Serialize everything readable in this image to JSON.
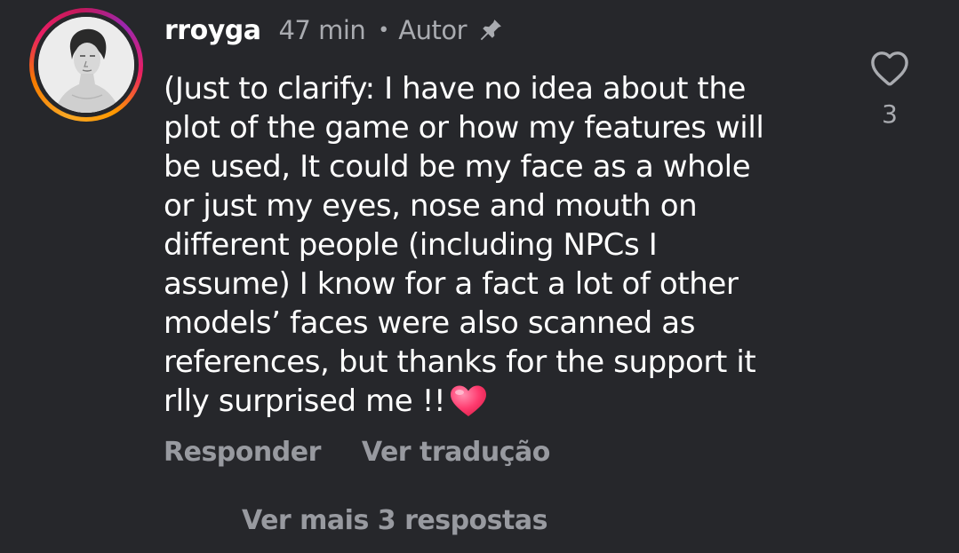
{
  "comment": {
    "username": "rroyga",
    "time": "47 min",
    "separator": "•",
    "role": "Autor",
    "pin_icon": "pin-icon",
    "avatar_icon": "avatar-photo",
    "text": "(Just to clarify: I have no idea about the\nplot of the game or how my features will\nbe used, It could be my face as a whole\nor just my eyes, nose and mouth on\ndifferent people (including NPCs I\nassume) I know for a fact a lot of other\nmodels’ faces were also scanned as\nreferences, but thanks for the support it\nrlly surprised me !!",
    "emoji_icon": "pink-heart-emoji",
    "like_icon": "heart-outline-icon",
    "like_count": "3"
  },
  "actions": {
    "reply_label": "Responder",
    "translate_label": "Ver tradução"
  },
  "replies": {
    "more_label": "Ver mais 3 respostas"
  },
  "colors": {
    "background": "#26272b",
    "text_primary": "#ffffff",
    "text_secondary": "#a9abb0",
    "emoji_heart": "#ff3b6f"
  }
}
